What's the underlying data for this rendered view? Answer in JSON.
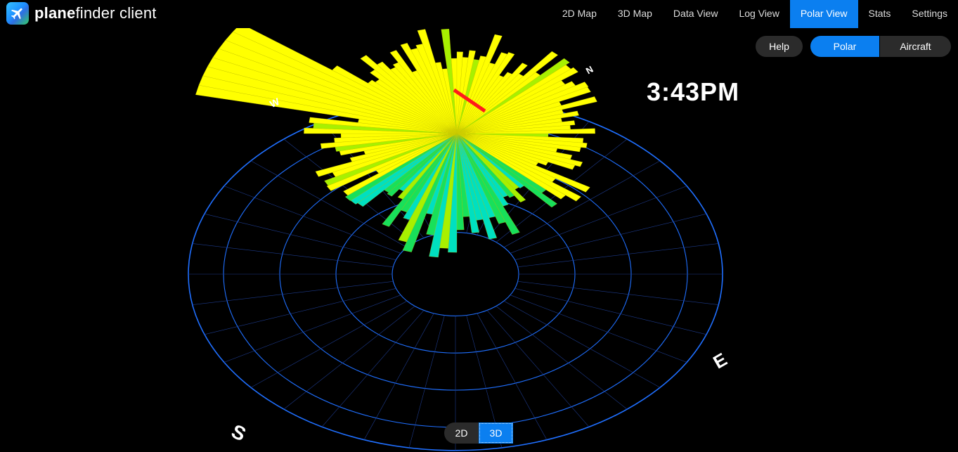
{
  "app": {
    "brand_bold": "plane",
    "brand_rest": "finder client"
  },
  "nav": {
    "items": [
      {
        "label": "2D Map",
        "active": false
      },
      {
        "label": "3D Map",
        "active": false
      },
      {
        "label": "Data View",
        "active": false
      },
      {
        "label": "Log View",
        "active": false
      },
      {
        "label": "Polar View",
        "active": true
      },
      {
        "label": "Stats",
        "active": false
      },
      {
        "label": "Settings",
        "active": false
      }
    ]
  },
  "controls": {
    "help_label": "Help",
    "polar_label": "Polar",
    "aircraft_label": "Aircraft",
    "active_mode": "Polar"
  },
  "clock": "3:43PM",
  "compass": {
    "n": "N",
    "e": "E",
    "s": "S",
    "w": "W"
  },
  "view_toggle": {
    "label_2d": "2D",
    "label_3d": "3D",
    "active": "3D"
  },
  "colors": {
    "accent": "#0b7ff0",
    "ring": "#1f6fff",
    "range_low": "#1e6bff",
    "range_mid": "#18e05a",
    "range_high": "#ffff00",
    "heading_needle": "#ff0000"
  }
}
